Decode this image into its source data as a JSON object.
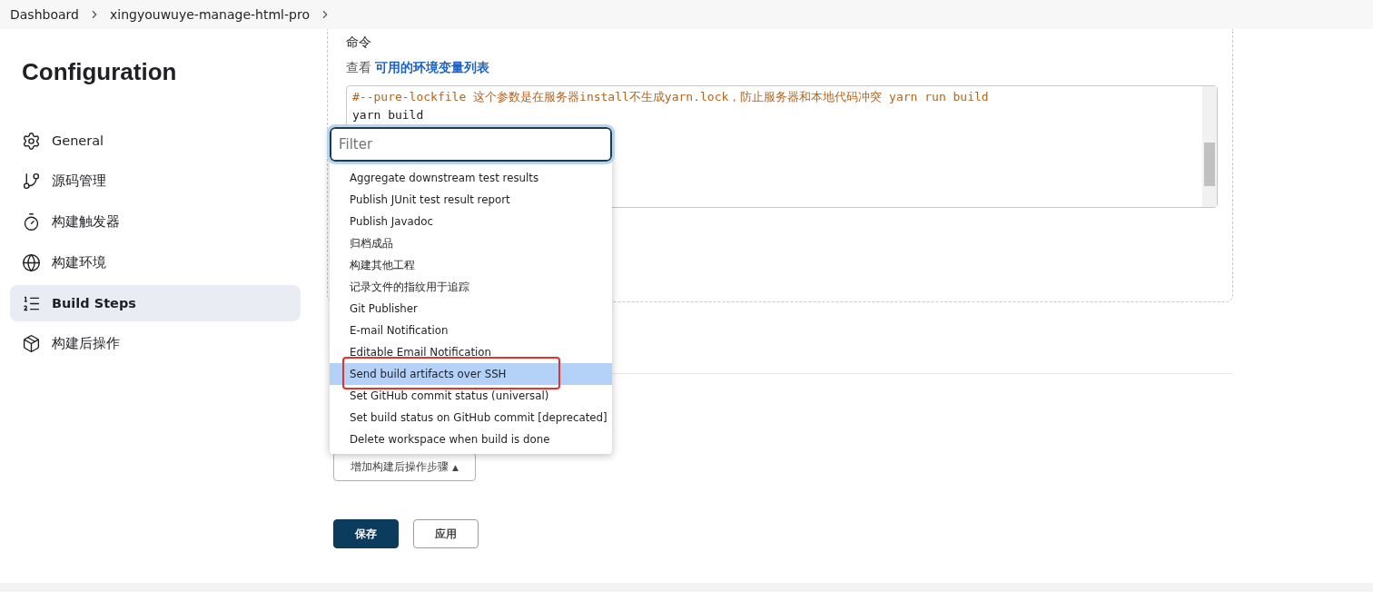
{
  "breadcrumb": [
    {
      "label": "Dashboard"
    },
    {
      "label": "xingyouwuye-manage-html-pro"
    }
  ],
  "page_title": "Configuration",
  "sidebar": {
    "items": [
      {
        "label": "General",
        "selected": false
      },
      {
        "label": "源码管理",
        "selected": false
      },
      {
        "label": "构建触发器",
        "selected": false
      },
      {
        "label": "构建环境",
        "selected": false
      },
      {
        "label": "Build Steps",
        "selected": true
      },
      {
        "label": "构建后操作",
        "selected": false
      }
    ]
  },
  "command": {
    "label": "命令",
    "help_prefix": "查看",
    "help_link": "可用的环境变量列表",
    "lines": [
      {
        "kind": "comment",
        "text": "#--pure-lockfile  这个参数是在服务器install不生成yarn.lock，防止服务器和本地代码冲突 yarn run build"
      },
      {
        "kind": "code",
        "text": "yarn build"
      }
    ]
  },
  "dropdown": {
    "placeholder": "Filter",
    "items": [
      {
        "label": "Aggregate downstream test results",
        "selected": false,
        "highlighted": false
      },
      {
        "label": "Publish JUnit test result report",
        "selected": false,
        "highlighted": false
      },
      {
        "label": "Publish Javadoc",
        "selected": false,
        "highlighted": false
      },
      {
        "label": "归档成品",
        "selected": false,
        "highlighted": false
      },
      {
        "label": "构建其他工程",
        "selected": false,
        "highlighted": false
      },
      {
        "label": "记录文件的指纹用于追踪",
        "selected": false,
        "highlighted": false
      },
      {
        "label": "Git Publisher",
        "selected": false,
        "highlighted": false
      },
      {
        "label": "E-mail Notification",
        "selected": false,
        "highlighted": false
      },
      {
        "label": "Editable Email Notification",
        "selected": false,
        "highlighted": false
      },
      {
        "label": "Send build artifacts over SSH",
        "selected": true,
        "highlighted": true
      },
      {
        "label": "Set GitHub commit status (universal)",
        "selected": false,
        "highlighted": false
      },
      {
        "label": "Set build status on GitHub commit [deprecated]",
        "selected": false,
        "highlighted": false
      },
      {
        "label": "Delete workspace when build is done",
        "selected": false,
        "highlighted": false
      }
    ]
  },
  "add_step_button": {
    "label": "增加构建后操作步骤",
    "caret": "▲"
  },
  "buttons": [
    {
      "label": "保存",
      "kind": "primary"
    },
    {
      "label": "应用",
      "kind": "secondary"
    }
  ]
}
